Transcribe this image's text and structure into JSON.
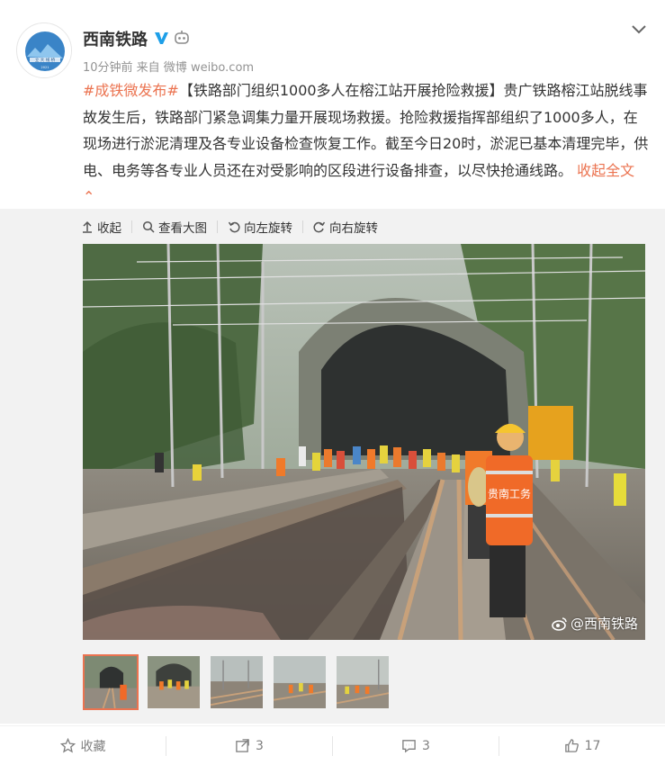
{
  "post": {
    "user_name": "西南铁路",
    "meta": "10分钟前 来自 微博 weibo.com",
    "hashtag": "#成铁微发布#",
    "body": "【铁路部门组织1000多人在榕江站开展抢险救援】贵广铁路榕江站脱线事故发生后，铁路部门紧急调集力量开展现场救援。抢险救援指挥部组织了1000多人，在现场进行淤泥清理及各专业设备检查恢复工作。截至今日20时，淤泥已基本清理完毕，供电、电务等各专业人员还在对受影响的区段进行设备排查，以尽快抢通线路。",
    "collapse_label": "收起全文",
    "avatar_text": "立 大 线 桥",
    "avatar_badge_text": "2021"
  },
  "toolbar": {
    "collapse": "收起",
    "view_large": "查看大图",
    "rotate_left": "向左旋转",
    "rotate_right": "向右旋转"
  },
  "photo": {
    "watermark": "@西南铁路",
    "vest_text": "贵南工务"
  },
  "footer": {
    "favorite": "收藏",
    "repost_count": "3",
    "comment_count": "3",
    "like_count": "17"
  },
  "colors": {
    "accent": "#eb7350",
    "verify_blue": "#1e9fe8"
  },
  "icons": [
    "verified-v-icon",
    "robot-icon",
    "chevron-down-icon",
    "arrow-up-icon",
    "search-icon",
    "rotate-left-icon",
    "rotate-right-icon",
    "star-icon",
    "share-icon",
    "comment-icon",
    "like-icon",
    "weibo-logo-icon"
  ]
}
